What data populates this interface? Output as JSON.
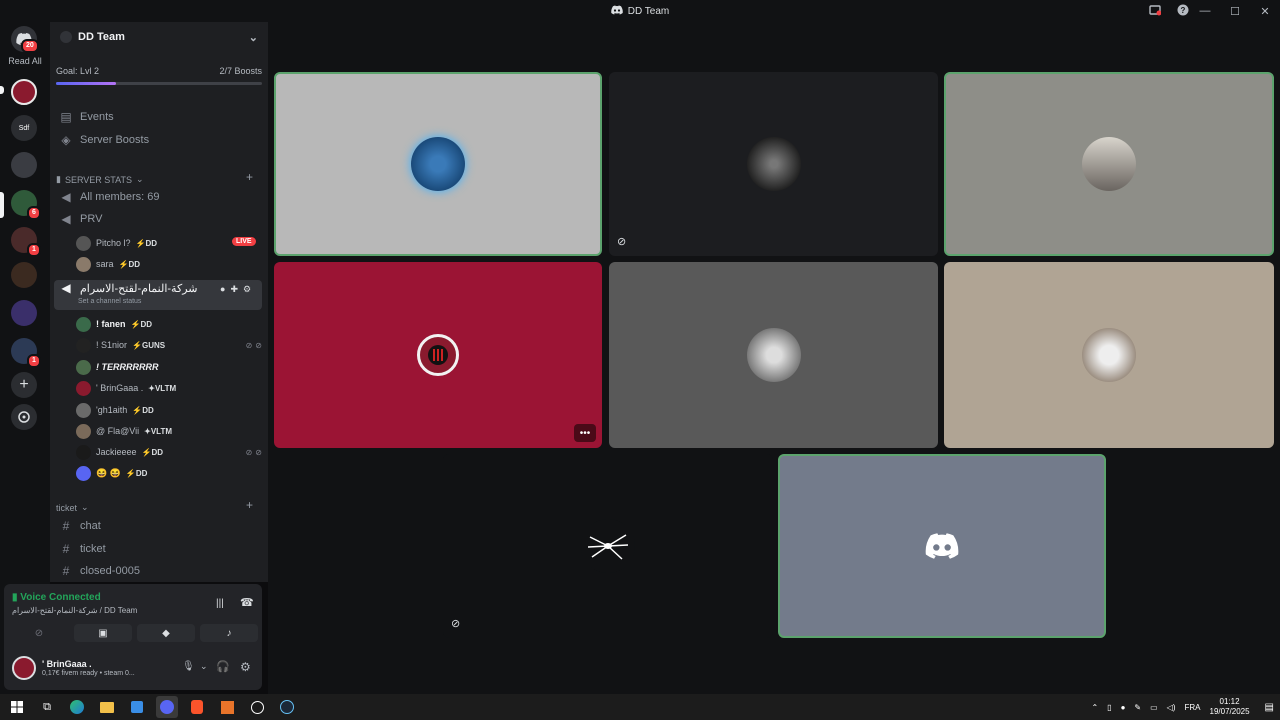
{
  "window": {
    "title": "DD Team"
  },
  "guilds": {
    "read_all": "Read All",
    "home_badge": "20",
    "badges": [
      "6",
      "1",
      "1"
    ],
    "labels": [
      "Sdf"
    ]
  },
  "server": {
    "name": "DD Team",
    "goal_label": "Goal: Lvl 2",
    "boosts": "2/7 Boosts",
    "goal_progress": 0.29
  },
  "channels": {
    "events": "Events",
    "server_boosts": "Server Boosts",
    "stats_category": "SERVER STATS",
    "all_members": "All members: 69",
    "prv": "PRV",
    "active_voice": "شركة-النمام-لقتح-الاسرام",
    "set_status": "Set a channel status",
    "ticket_category": "ticket",
    "text": [
      "chat",
      "ticket",
      "closed-0005"
    ]
  },
  "prv_users": [
    {
      "name": "Pitcho l?",
      "tag": "DD",
      "live": "LIVE"
    },
    {
      "name": "sara",
      "tag": "DD"
    }
  ],
  "voice_users": [
    {
      "name": "! fanen",
      "tag": "DD"
    },
    {
      "name": "! S1nior",
      "tag": "GUNS"
    },
    {
      "name": "! TERRRRRRR",
      "tag": ""
    },
    {
      "name": "' BrinGaaa .",
      "tag": "VLTM"
    },
    {
      "name": "'gh1aith",
      "tag": "DD"
    },
    {
      "name": "@ Fla@Vii",
      "tag": "VLTM"
    },
    {
      "name": "Jackieeee",
      "tag": "DD"
    },
    {
      "name": "😆 😆",
      "tag": "DD"
    }
  ],
  "voice_panel": {
    "status": "Voice Connected",
    "location": "شركة-النمام-لقتح-الاسرام / DD Team"
  },
  "user": {
    "name": "' BrinGaaa .",
    "status": "0,17€ fivem ready • steam 0..."
  },
  "taskbar": {
    "lang": "FRA",
    "time": "01:12",
    "date": "19/07/2025"
  },
  "colors": {
    "speaking": "#5ca36d",
    "accent": "#5865f2",
    "danger": "#f23f43",
    "online": "#23a55a"
  }
}
